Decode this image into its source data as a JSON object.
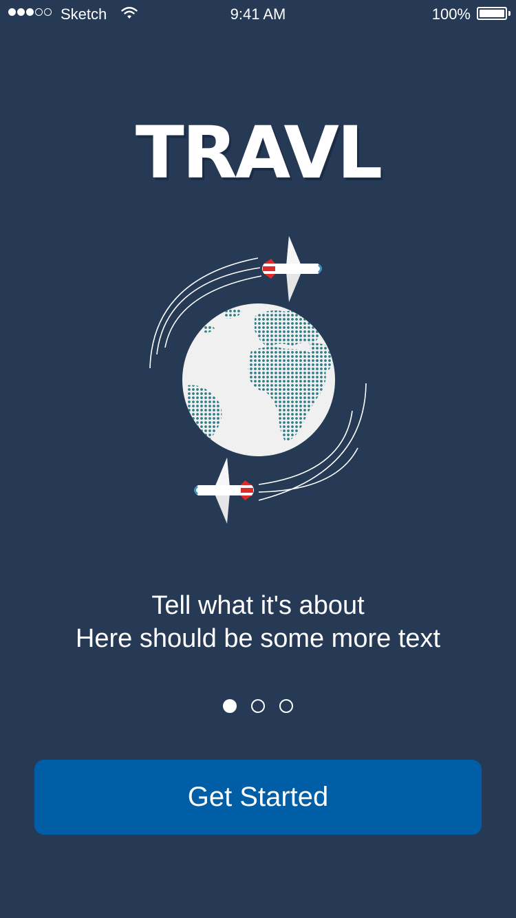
{
  "status_bar": {
    "carrier": "Sketch",
    "time": "9:41 AM",
    "battery": "100%",
    "signal_bars": 3,
    "signal_max": 5
  },
  "app": {
    "logo": "TRAVL"
  },
  "illustration": {
    "icon": "globe-with-airplanes",
    "colors": {
      "globe": "#f0f0f0",
      "land": "#2f7d88",
      "plane_body": "#ffffff",
      "plane_tail": "#e02a2a",
      "plane_window": "#3a8fbf"
    }
  },
  "onboarding": {
    "line1": "Tell what it's about",
    "line2": "Here should be some more text",
    "current_page": 1,
    "total_pages": 3
  },
  "cta": {
    "label": "Get Started"
  },
  "colors": {
    "background": "#263a55",
    "button": "#005ea7",
    "text": "#ffffff"
  }
}
